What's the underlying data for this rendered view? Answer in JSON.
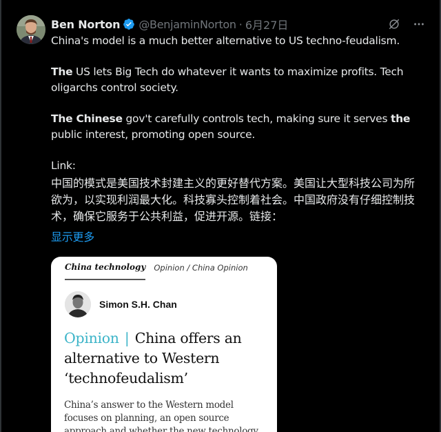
{
  "tweet": {
    "author_name": "Ben Norton",
    "handle": "@BenjaminNorton",
    "separator": "·",
    "date": "6月27日",
    "text": {
      "line1": "China's model is a much better alternative to US techno-feudalism.",
      "p2_bold": "The",
      "p2_rest": " US lets Big Tech do whatever it wants to maximize profits. Tech oligarchs control society.",
      "p3_bold1": "The Chinese",
      "p3_mid": " gov't carefully controls tech, making sure it serves ",
      "p3_bold2": "the",
      "p3_rest": " public interest, promoting open source.",
      "link_label": "Link:"
    },
    "translation": "中国的模式是美国技术封建主义的更好替代方案。美国让大型科技公司为所欲为，以实现利润最大化。科技寡头控制着社会。中国政府没有仔细控制技术，确保它服务于公共利益，促进开源。链接：",
    "show_more": "显示更多"
  },
  "card": {
    "section": "China technology",
    "breadcrumb": "Opinion / China Opinion",
    "byline": "Simon S.H. Chan",
    "headline_label": "Opinion",
    "headline_sep": "|",
    "headline_text": "China offers an alternative to Western ‘technofeudalism’",
    "summary": "China’s answer to the Western model focuses on planning, an open source approach and whether the new technology earns its place in society"
  },
  "icons": {
    "verified": "verified-badge-icon",
    "grok": "grok-icon",
    "more": "more-options-icon"
  },
  "colors": {
    "background": "#000000",
    "link_blue": "#1d9bf0",
    "muted": "#71767b",
    "opinion_teal": "#3cb4c8"
  }
}
